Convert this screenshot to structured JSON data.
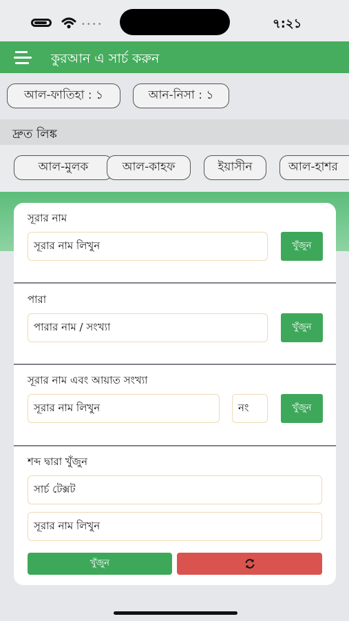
{
  "status_bar": {
    "time": "৭:২১",
    "carrier_dots": "•••• "
  },
  "header": {
    "title": "কুরআন এ সার্চ করুন"
  },
  "recent": [
    {
      "label": "আল-ফাতিহা : ১"
    },
    {
      "label": "আন-নিসা : ১"
    }
  ],
  "quick_links": {
    "title": "দ্রুত লিঙ্ক",
    "items": [
      {
        "label": "আল-মুলক"
      },
      {
        "label": "আল-কাহফ"
      },
      {
        "label": "ইয়াসীন"
      },
      {
        "label": "আল-হাশর"
      }
    ]
  },
  "sections": {
    "surah": {
      "label": "সূরার নাম",
      "placeholder": "সূরার নাম লিখুন",
      "button": "খুঁজুন"
    },
    "para": {
      "label": "পারা",
      "placeholder": "পারার নাম / সংখ্যা",
      "button": "খুঁজুন"
    },
    "ayah": {
      "label": "সূরার নাম এবং আয়াত সংখ্যা",
      "placeholder": "সূরার নাম লিখুন",
      "number_placeholder": "নং",
      "button": "খুঁজুন"
    },
    "word": {
      "label": "শব্দ দ্বারা খুঁজুন",
      "text_placeholder": "সার্চ টেক্সট",
      "surah_placeholder": "সূরার নাম লিখুন",
      "button": "খুঁজুন",
      "reset_icon": "refresh-icon"
    }
  },
  "colors": {
    "primary": "#45ad5d",
    "button_green": "#3ea85a",
    "button_red": "#d9534f",
    "field_border": "#f0d9b5"
  }
}
